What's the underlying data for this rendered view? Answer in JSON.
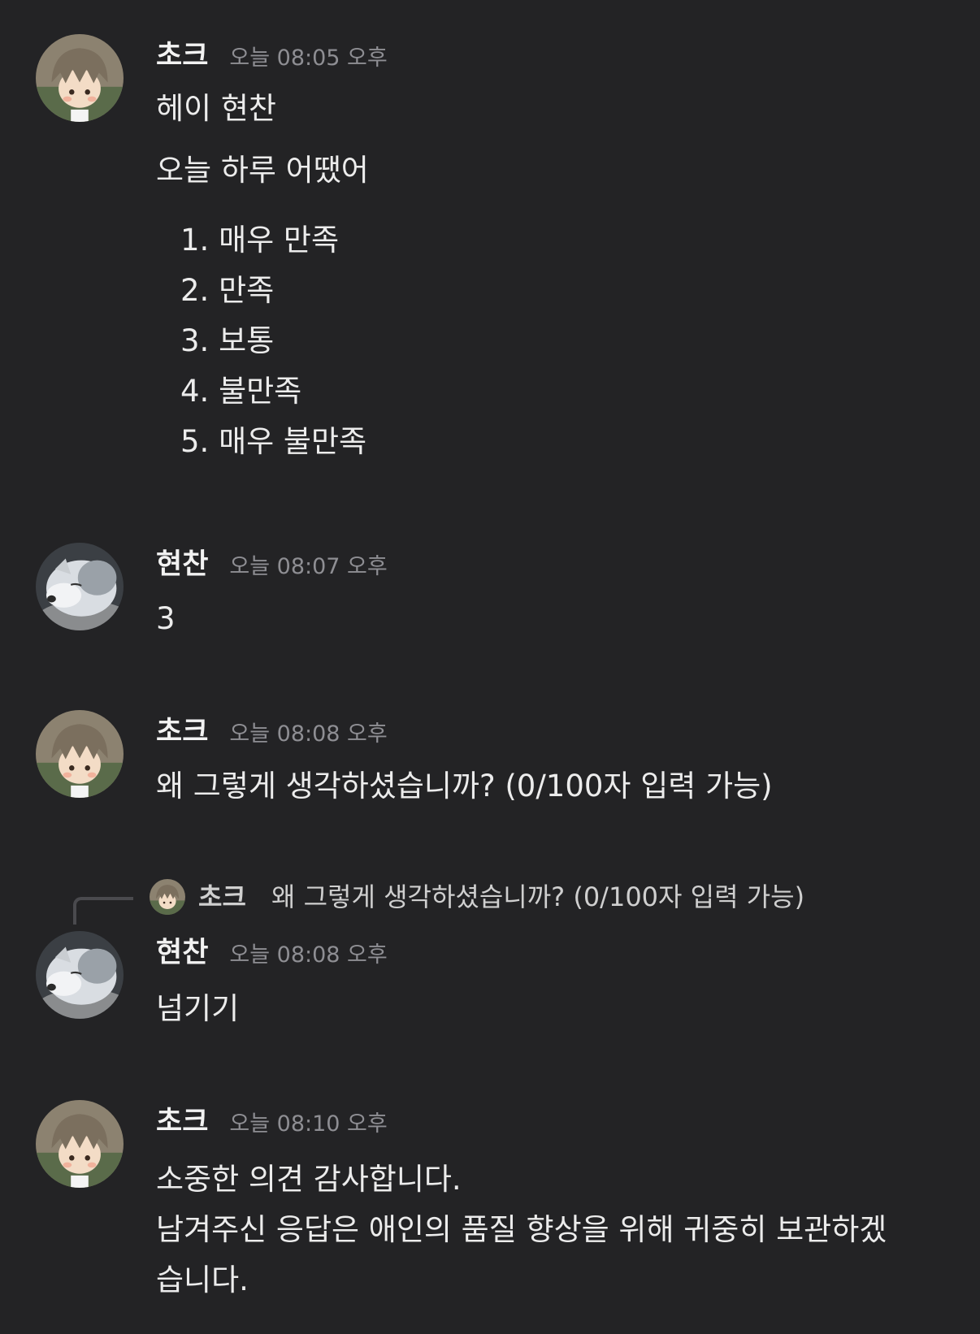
{
  "messages": [
    {
      "author": "초크",
      "time": "오늘 08:05 오후",
      "avatar_icon": "chalk-avatar-icon",
      "lines": [
        "헤이 현찬",
        "오늘 하루 어땠어"
      ],
      "list": [
        "1. 매우 만족",
        "2. 만족",
        "3. 보통",
        "4. 불만족",
        "5. 매우 불만족"
      ]
    },
    {
      "author": "현찬",
      "time": "오늘 08:07 오후",
      "avatar_icon": "dog-avatar-icon",
      "lines": [
        "3"
      ]
    },
    {
      "author": "초크",
      "time": "오늘 08:08 오후",
      "avatar_icon": "chalk-avatar-icon",
      "lines": [
        "왜 그렇게 생각하셨습니까? (0/100자 입력 가능)"
      ]
    },
    {
      "author": "현찬",
      "time": "오늘 08:08 오후",
      "avatar_icon": "dog-avatar-icon",
      "reply_to": {
        "author": "초크",
        "text": "왜 그렇게 생각하셨습니까? (0/100자 입력 가능)"
      },
      "lines": [
        "넘기기"
      ]
    },
    {
      "author": "초크",
      "time": "오늘 08:10 오후",
      "avatar_icon": "chalk-avatar-icon",
      "lines": [
        "소중한 의견 감사합니다.",
        "남겨주신 응답은 애인의 품질 향상을 위해 귀중히 보관하겠",
        "습니다."
      ]
    }
  ],
  "colors": {
    "background": "#232325",
    "text": "#ececec",
    "timestamp": "#8e8e93"
  }
}
